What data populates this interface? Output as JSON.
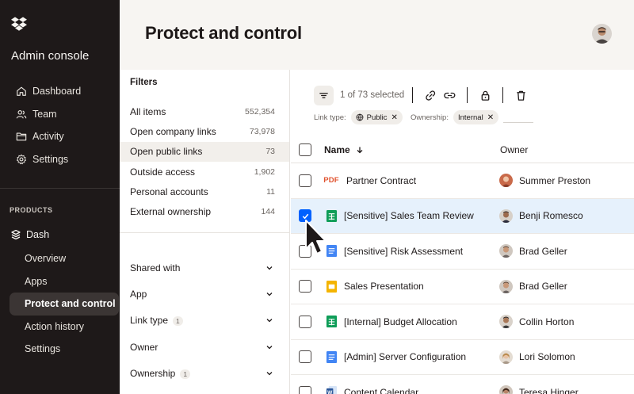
{
  "sidebar": {
    "title": "Admin console",
    "nav": [
      {
        "label": "Dashboard",
        "icon": "home-icon"
      },
      {
        "label": "Team",
        "icon": "team-icon"
      },
      {
        "label": "Activity",
        "icon": "activity-icon"
      },
      {
        "label": "Settings",
        "icon": "gear-icon"
      }
    ],
    "products_label": "PRODUCTS",
    "product": {
      "label": "Dash",
      "icon": "dash-icon"
    },
    "subnav": [
      {
        "label": "Overview",
        "active": false
      },
      {
        "label": "Apps",
        "active": false
      },
      {
        "label": "Protect and control",
        "active": true
      },
      {
        "label": "Action history",
        "active": false
      },
      {
        "label": "Settings",
        "active": false
      }
    ]
  },
  "header": {
    "title": "Protect and control"
  },
  "filters": {
    "title": "Filters",
    "items": [
      {
        "label": "All items",
        "count": "552,354"
      },
      {
        "label": "Open company links",
        "count": "73,978"
      },
      {
        "label": "Open public links",
        "count": "73"
      },
      {
        "label": "Outside access",
        "count": "1,902"
      },
      {
        "label": "Personal accounts",
        "count": "11"
      },
      {
        "label": "External ownership",
        "count": "144"
      }
    ],
    "selected_index": 2,
    "accordions": [
      {
        "label": "Shared with",
        "badge": ""
      },
      {
        "label": "App",
        "badge": ""
      },
      {
        "label": "Link type",
        "badge": "1"
      },
      {
        "label": "Owner",
        "badge": ""
      },
      {
        "label": "Ownership",
        "badge": "1"
      }
    ]
  },
  "toolbar": {
    "selected_text": "1 of 73 selected"
  },
  "chips": {
    "link_type_label": "Link type:",
    "link_type_value": "Public",
    "ownership_label": "Ownership:",
    "ownership_value": "Internal"
  },
  "table": {
    "col_name": "Name",
    "col_owner": "Owner",
    "rows": [
      {
        "name": "Partner Contract",
        "type": "pdf",
        "owner": "Summer Preston",
        "checked": false
      },
      {
        "name": "[Sensitive] Sales Team Review",
        "type": "sheet",
        "owner": "Benji Romesco",
        "checked": true
      },
      {
        "name": "[Sensitive] Risk Assessment",
        "type": "doc",
        "owner": "Brad Geller",
        "checked": false
      },
      {
        "name": "Sales Presentation",
        "type": "slides",
        "owner": "Brad Geller",
        "checked": false
      },
      {
        "name": "[Internal] Budget Allocation",
        "type": "sheet",
        "owner": "Collin Horton",
        "checked": false
      },
      {
        "name": "[Admin] Server Configuration",
        "type": "doc",
        "owner": "Lori Solomon",
        "checked": false
      },
      {
        "name": "Content Calendar",
        "type": "word",
        "owner": "Teresa Hinger",
        "checked": false
      }
    ],
    "pdf_label": "PDF"
  },
  "colors": {
    "sidebar_bg": "#1e1919",
    "accent_blue": "#0061fe",
    "selected_row": "#e6f1fc",
    "header_bg": "#f7f5f2"
  }
}
